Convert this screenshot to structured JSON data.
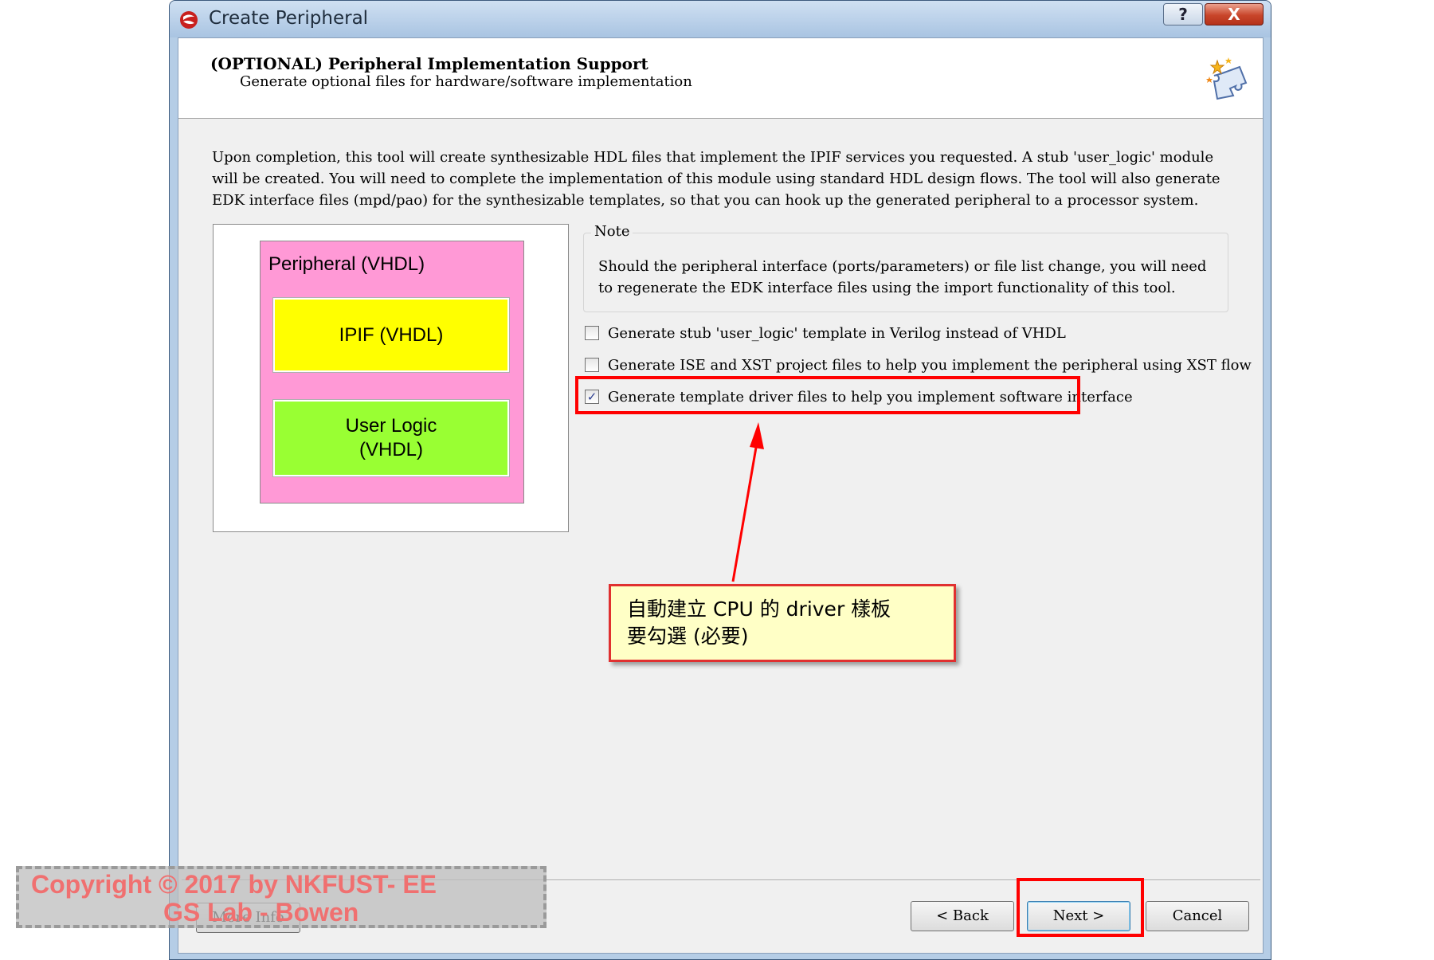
{
  "window": {
    "title": "Create Peripheral",
    "help_label": "?",
    "close_label": "X"
  },
  "header": {
    "title": "(OPTIONAL) Peripheral Implementation Support",
    "subtitle": "Generate optional files for hardware/software implementation"
  },
  "description": "Upon completion, this tool will create synthesizable HDL files that implement the IPIF services you requested. A stub 'user_logic' module will be created. You will need to complete the implementation of this module using standard HDL design flows. The tool will also generate EDK interface files (mpd/pao) for the synthesizable templates, so that you can hook up the generated peripheral to a processor system.",
  "diagram": {
    "peripheral_label": "Peripheral (VHDL)",
    "ipif_label": "IPIF (VHDL)",
    "user_logic_line1": "User Logic",
    "user_logic_line2": "(VHDL)",
    "colors": {
      "peripheral": "#ff99d6",
      "ipif": "#ffff00",
      "user_logic": "#99ff33"
    }
  },
  "note": {
    "legend": "Note",
    "text": "Should the peripheral interface (ports/parameters) or file list change, you will need to regenerate the EDK interface files using the import functionality of this tool."
  },
  "options": [
    {
      "label": "Generate stub 'user_logic' template in Verilog instead of VHDL",
      "checked": false
    },
    {
      "label": "Generate ISE and XST project files to help you implement the peripheral using XST flow",
      "checked": false
    },
    {
      "label": "Generate template driver files to help you implement software interface",
      "checked": true
    }
  ],
  "callout": {
    "line1": "自動建立 CPU 的 driver 樣板",
    "line2": "要勾選 (必要)",
    "highlight_color": "#ff0000"
  },
  "buttons": {
    "more_info": "More Info",
    "back": "< Back",
    "next": "Next >",
    "cancel": "Cancel"
  },
  "watermark": {
    "line1": "Copyright © 2017 by NKFUST- EE",
    "line2": "GS Lab - Bowen"
  }
}
